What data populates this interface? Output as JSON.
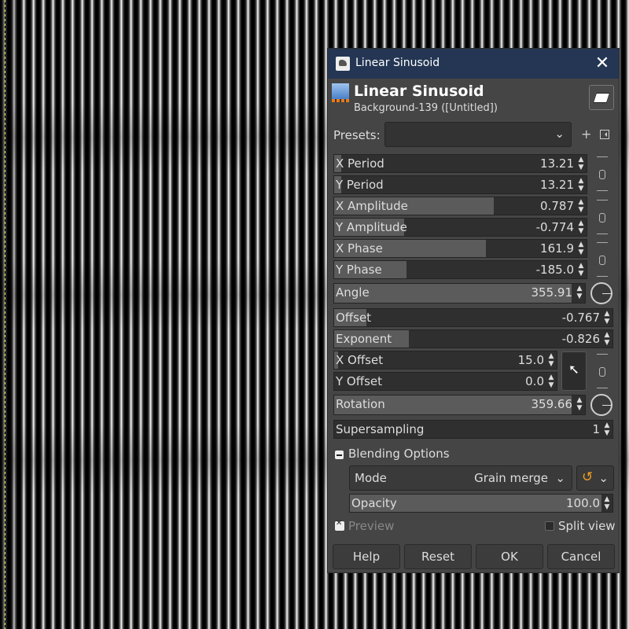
{
  "dialog": {
    "window_title": "Linear Sinusoid",
    "filter_name": "Linear Sinusoid",
    "layer_info": "Background-139 ([Untitled])",
    "close_symbol": "✕"
  },
  "presets": {
    "label": "Presets:",
    "value": "",
    "add_symbol": "+"
  },
  "params": {
    "x_period": {
      "label": "X Period",
      "value": "13.21",
      "fill": 0.03
    },
    "y_period": {
      "label": "Y Period",
      "value": "13.21",
      "fill": 0.03
    },
    "x_amplitude": {
      "label": "X Amplitude",
      "value": "0.787",
      "fill": 0.66
    },
    "y_amplitude": {
      "label": "Y Amplitude",
      "value": "-0.774",
      "fill": 0.29
    },
    "x_phase": {
      "label": "X Phase",
      "value": "161.9",
      "fill": 0.63
    },
    "y_phase": {
      "label": "Y Phase",
      "value": "-185.0",
      "fill": 0.3
    },
    "angle": {
      "label": "Angle",
      "value": "355.91",
      "fill": 0.99
    },
    "offset": {
      "label": "Offset",
      "value": "-0.767",
      "fill": 0.12
    },
    "exponent": {
      "label": "Exponent",
      "value": "-0.826",
      "fill": 0.28
    },
    "x_offset": {
      "label": "X Offset",
      "value": "15.0",
      "fill": 0.02
    },
    "y_offset": {
      "label": "Y Offset",
      "value": "0.0",
      "fill": 0.0
    },
    "rotation": {
      "label": "Rotation",
      "value": "359.66",
      "fill": 0.99
    },
    "supersampling": {
      "label": "Supersampling",
      "value": "1",
      "fill": 0.0
    }
  },
  "blending": {
    "title": "Blending Options",
    "mode_label": "Mode",
    "mode_value": "Grain merge",
    "opacity_label": "Opacity",
    "opacity_value": "100.0",
    "opacity_fill": 1.0
  },
  "preview": {
    "label": "Preview",
    "checked": true
  },
  "split_view": {
    "label": "Split view",
    "checked": false
  },
  "buttons": {
    "help": "Help",
    "reset": "Reset",
    "ok": "OK",
    "cancel": "Cancel"
  },
  "icons": {
    "chevron": "chevron-down-icon",
    "spin": "spin-arrows-icon",
    "chain": "chain-link-icon",
    "dial": "angle-dial-icon",
    "picker": "pointer-pick-icon"
  },
  "colors": {
    "titlebar": "#243654",
    "panel": "#454545",
    "accent": "#f0a020"
  }
}
